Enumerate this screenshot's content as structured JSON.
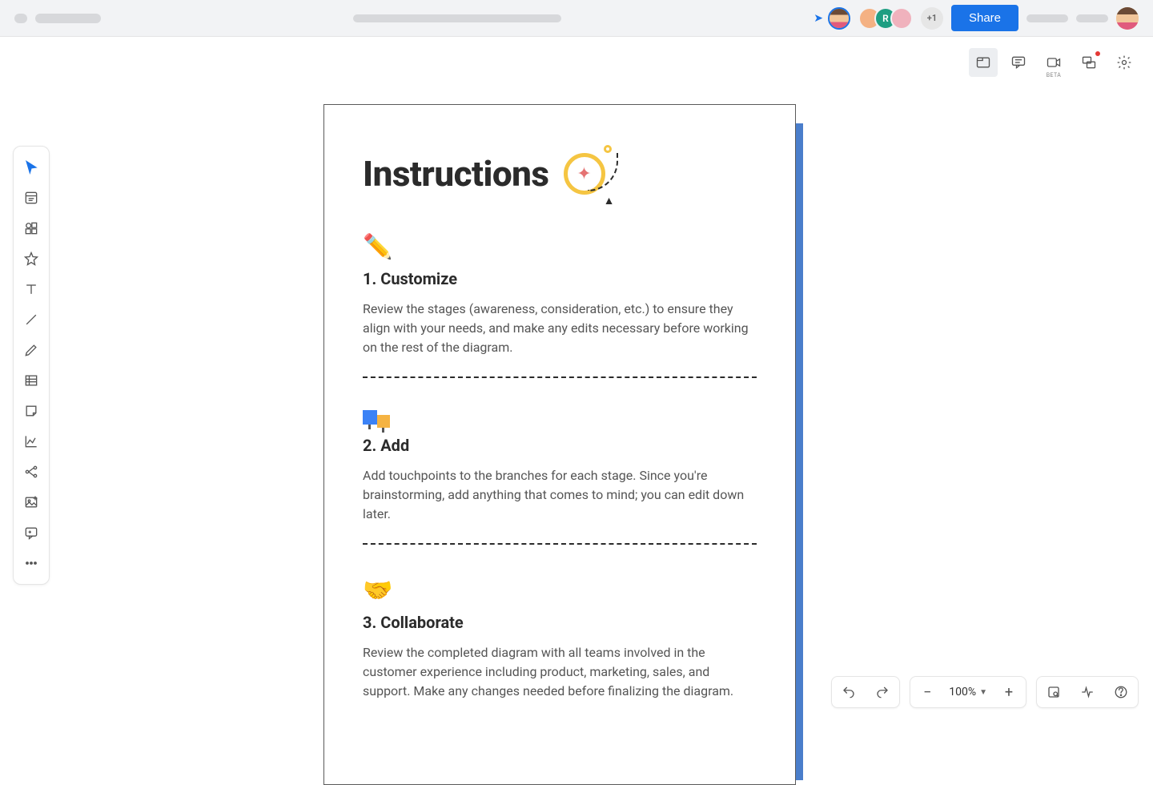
{
  "topbar": {
    "share_label": "Share",
    "extra_avatars_label": "+1",
    "avatar_r_label": "R"
  },
  "right_icons": {
    "beta_label": "BETA"
  },
  "zoom": {
    "level": "100%",
    "minus": "−",
    "plus": "+"
  },
  "doc": {
    "title": "Instructions",
    "sections": [
      {
        "icon": "✏️",
        "title": "1. Customize",
        "body": "Review the stages (awareness, consideration, etc.) to ensure they align with your needs, and make any edits necessary before working on the rest of the diagram."
      },
      {
        "icon": "stickies",
        "title": "2. Add",
        "body": "Add touchpoints to the branches for each stage. Since you're brainstorming, add anything that comes to mind; you can edit down later."
      },
      {
        "icon": "🤝",
        "title": "3. Collaborate",
        "body": "Review the completed diagram with all teams involved in the customer experience including product, marketing, sales, and support. Make any changes needed before finalizing the diagram."
      }
    ]
  }
}
